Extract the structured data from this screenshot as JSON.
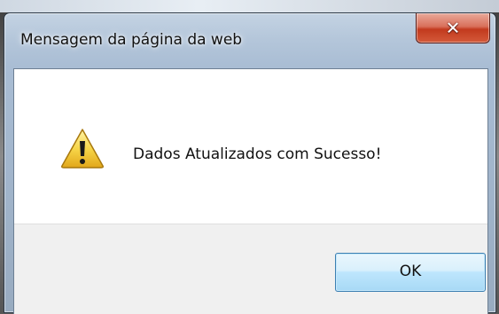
{
  "dialog": {
    "title": "Mensagem da página da web",
    "close_icon": "close-icon",
    "message": "Dados Atualizados com Sucesso!",
    "message_icon": "warning-icon",
    "ok_label": "OK"
  },
  "colors": {
    "warning_yellow": "#f7d64a",
    "close_red": "#c23a1e",
    "ok_border": "#3c7fb1",
    "button_area_bg": "#f0f0f0"
  }
}
